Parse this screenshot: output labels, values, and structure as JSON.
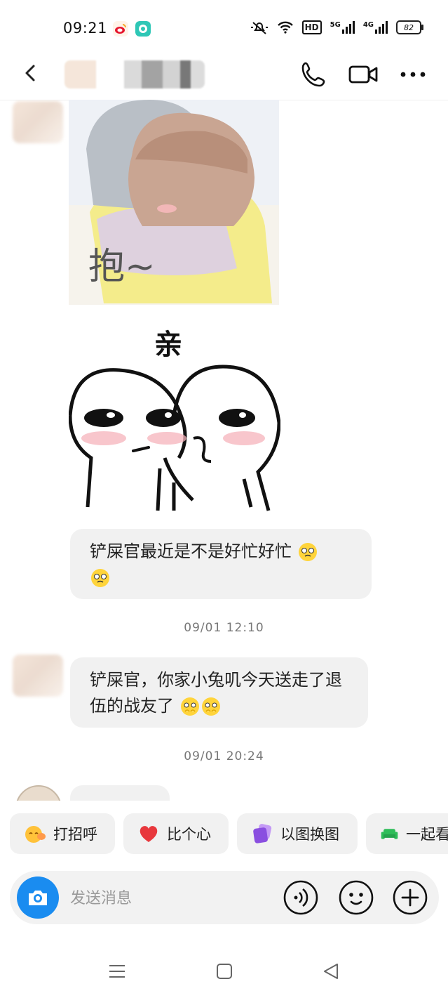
{
  "status_bar": {
    "time": "09:21",
    "signal_1_label": "5G",
    "signal_2_label": "4G",
    "hd_label": "HD",
    "battery": "82",
    "icons": [
      "weibo-icon",
      "chat-app-icon",
      "silent-bell-icon",
      "wifi-icon",
      "hd-icon",
      "signal-5g-icon",
      "signal-4g-icon",
      "battery-icon"
    ]
  },
  "header": {
    "icons": [
      "back-icon",
      "phone-icon",
      "video-call-icon",
      "more-icon"
    ]
  },
  "messages": {
    "sticker1_text": "抱~",
    "sticker2_text": "亲",
    "bubble1_text": "铲屎官最近是不是好忙好忙",
    "timestamp1": "09/01 12:10",
    "bubble2_text": "铲屎官，你家小兔叽今天送走了退伍的战友了",
    "timestamp2": "09/01 20:24"
  },
  "quick_actions": [
    {
      "label": "打招呼",
      "icon": "wave-emoji-icon"
    },
    {
      "label": "比个心",
      "icon": "heart-icon"
    },
    {
      "label": "以图换图",
      "icon": "image-swap-icon"
    },
    {
      "label": "一起看",
      "icon": "sofa-icon"
    }
  ],
  "input": {
    "placeholder": "发送消息",
    "icons": [
      "camera-icon",
      "voice-icon",
      "emoji-face-icon",
      "plus-icon"
    ]
  },
  "nav": {
    "icons": [
      "menu-icon",
      "home-square-icon",
      "back-triangle-icon"
    ]
  },
  "colors": {
    "accent": "#1a8cf0",
    "bubble": "#f1f1f1",
    "heart": "#e8383d",
    "sofa": "#2ebd59",
    "swap": "#8a4fe0"
  }
}
